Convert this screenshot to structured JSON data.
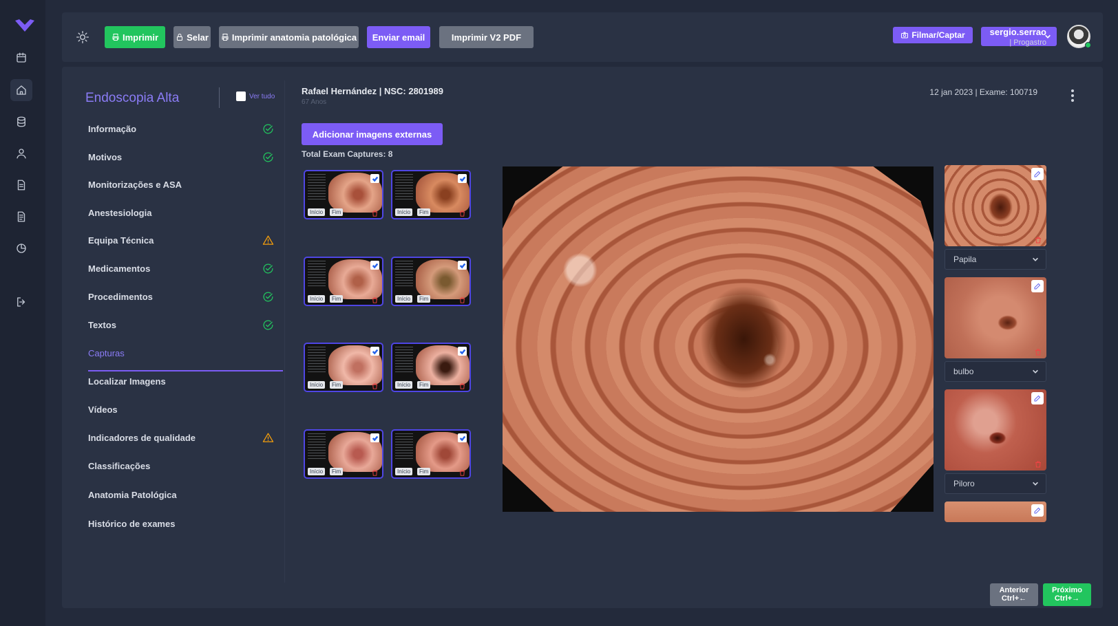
{
  "toolbar": {
    "print_label": "Imprimir",
    "seal_label": "Selar",
    "print_pathology_label": "Imprimir anatomia patológica",
    "send_email_label": "Enviar email",
    "print_v2_label": "Imprimir V2 PDF",
    "film_capture_label": "Filmar/Captar",
    "select_value": ""
  },
  "user": {
    "name": "sergio.serrao",
    "role": "| Progastro"
  },
  "sidebar": {
    "title": "Endoscopia Alta",
    "ver_tudo_label": "Ver tudo",
    "items": [
      {
        "label": "Informação",
        "status": "ok"
      },
      {
        "label": "Motivos",
        "status": "ok"
      },
      {
        "label": "Monitorizações e ASA",
        "status": ""
      },
      {
        "label": "Anestesiologia",
        "status": ""
      },
      {
        "label": "Equipa Técnica",
        "status": "warn"
      },
      {
        "label": "Medicamentos",
        "status": "ok"
      },
      {
        "label": "Procedimentos",
        "status": "ok"
      },
      {
        "label": "Textos",
        "status": "ok"
      },
      {
        "label": "Capturas",
        "status": "active"
      },
      {
        "label": "Localizar Imagens",
        "status": ""
      },
      {
        "label": "Vídeos",
        "status": ""
      },
      {
        "label": "Indicadores de qualidade",
        "status": "warn"
      },
      {
        "label": "Classificações",
        "status": ""
      },
      {
        "label": "Anatomia Patológica",
        "status": ""
      },
      {
        "label": "Histórico de exames",
        "status": ""
      }
    ]
  },
  "patient": {
    "name_line": "Rafael Hernández | NSC: 2801989",
    "age": "67 Anos",
    "exam_line": "12 jan 2023 | Exame: 100719"
  },
  "captures": {
    "add_button_label": "Adicionar imagens externas",
    "total_label": "Total Exam Captures: 8",
    "start_tag": "Início",
    "end_tag": "Fim"
  },
  "classified": [
    {
      "label": "Papila"
    },
    {
      "label": "bulbo"
    },
    {
      "label": "Piloro"
    }
  ],
  "nav": {
    "prev_label": "Anterior",
    "prev_shortcut": "Ctrl+←",
    "next_label": "Próximo",
    "next_shortcut": "Ctrl+→"
  },
  "colors": {
    "accent": "#7c5cf5",
    "success": "#22c55e",
    "warning": "#f59e0b",
    "danger": "#ef4444"
  }
}
